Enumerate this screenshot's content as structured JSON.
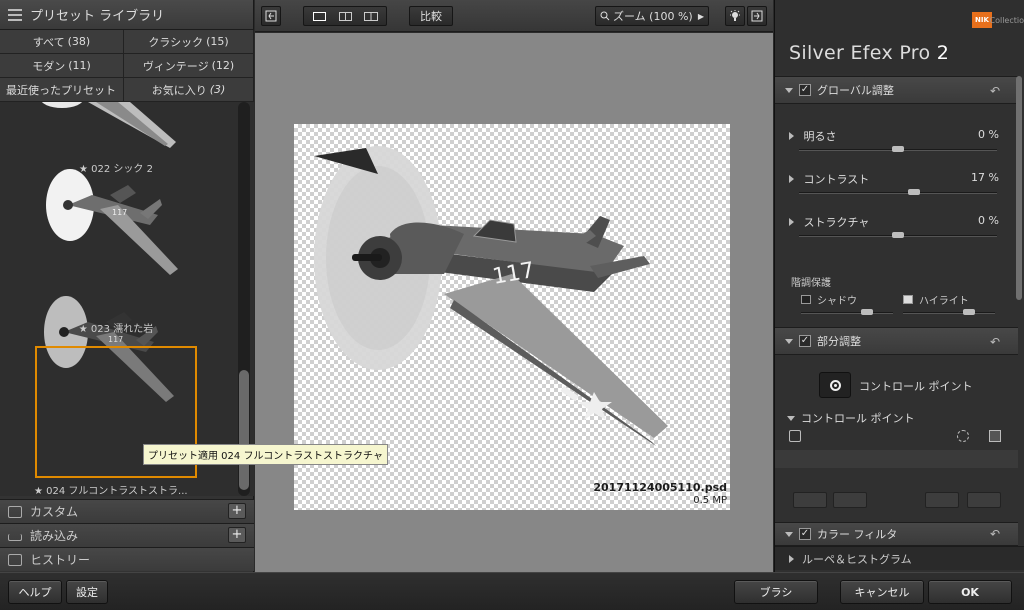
{
  "library": {
    "title": "プリセット ライブラリ",
    "filters": [
      {
        "label": "すべて",
        "count": "(38)"
      },
      {
        "label": "クラシック",
        "count": "(15)"
      },
      {
        "label": "モダン",
        "count": "(11)"
      },
      {
        "label": "ヴィンテージ",
        "count": "(12)"
      },
      {
        "label": "最近使ったプリセット",
        "count": ""
      },
      {
        "label": "お気に入り",
        "count": "(3)"
      }
    ],
    "presets": [
      {
        "label": "★ 022 シック 2"
      },
      {
        "label": "★ 023 濡れた岩"
      },
      {
        "label": "★ 024 フルコントラストストラ..."
      }
    ],
    "tooltip": "プリセット適用 024 フルコントラストストラクチャ",
    "sections": [
      {
        "label": "カスタム"
      },
      {
        "label": "読み込み"
      },
      {
        "label": "ヒストリー"
      }
    ]
  },
  "toolbar": {
    "compare_label": "比較",
    "zoom_label": "ズーム (100 %)"
  },
  "preview": {
    "filename": "20171124005110.psd",
    "size": "0.5 MP"
  },
  "panel": {
    "brand": "NIK",
    "collection": "Collectio",
    "product": "Silver Efex Pro",
    "version": "2",
    "global_title": "グローバル調整",
    "sliders": [
      {
        "label": "明るさ",
        "value": "0 %",
        "level": 0.5
      },
      {
        "label": "コントラスト",
        "value": "17 %",
        "level": 0.58
      },
      {
        "label": "ストラクチャ",
        "value": "0 %",
        "level": 0.5
      }
    ],
    "tone_title": "階調保護",
    "shadow_label": "シャドウ",
    "highlight_label": "ハイライト",
    "local_title": "部分調整",
    "control_point_button": "コントロール ポイント",
    "control_point_list": "コントロール ポイント",
    "color_filter_title": "カラー フィルタ",
    "loupe_title": "ルーペ＆ヒストグラム"
  },
  "bottom": {
    "help": "ヘルプ",
    "settings": "設定",
    "brush": "ブラシ",
    "cancel": "キャンセル",
    "ok": "OK"
  }
}
